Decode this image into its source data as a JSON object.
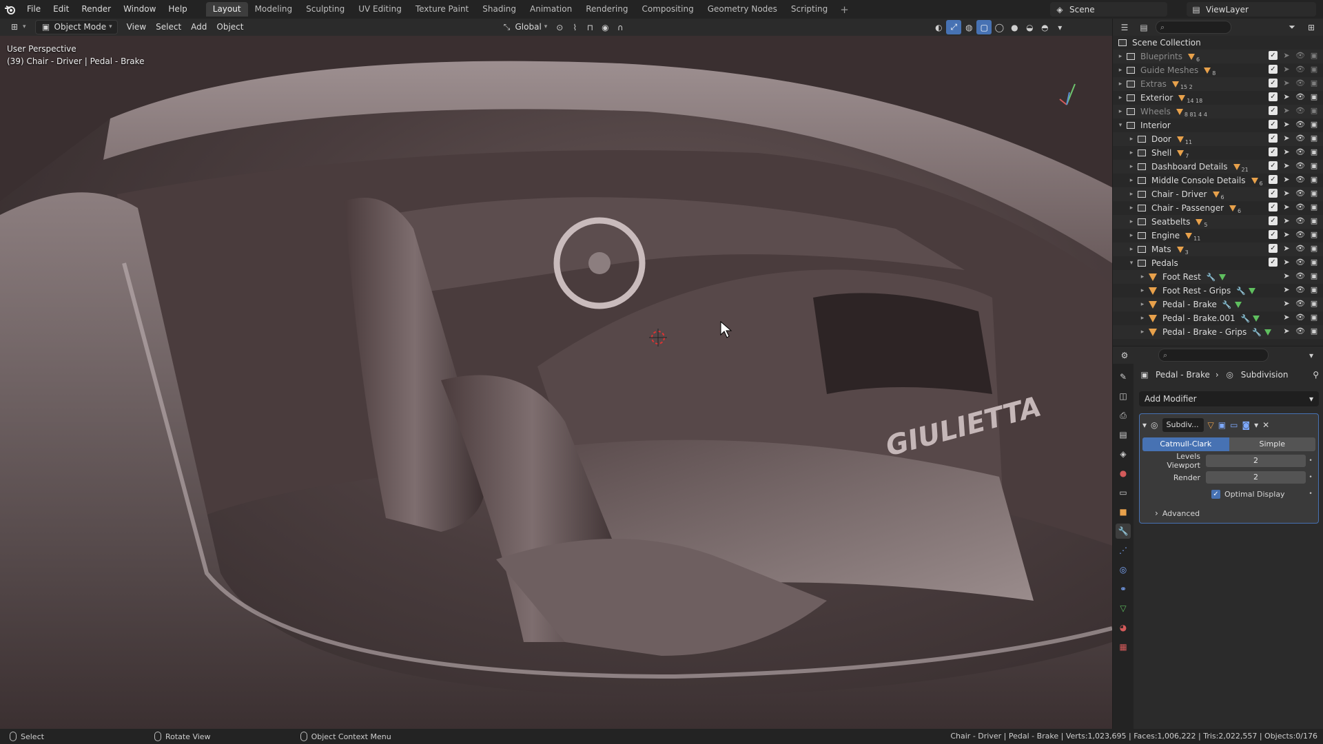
{
  "topbar": {
    "menus": [
      "File",
      "Edit",
      "Render",
      "Window",
      "Help"
    ],
    "workspaces": [
      "Layout",
      "Modeling",
      "Sculpting",
      "UV Editing",
      "Texture Paint",
      "Shading",
      "Animation",
      "Rendering",
      "Compositing",
      "Geometry Nodes",
      "Scripting"
    ],
    "active_workspace": "Layout",
    "add_workspace": "+",
    "scene": "Scene",
    "view_layer": "ViewLayer"
  },
  "viewport_header": {
    "mode": "Object Mode",
    "menus": [
      "View",
      "Select",
      "Add",
      "Object"
    ],
    "orientation": "Global"
  },
  "viewport": {
    "perspective_label": "User Perspective",
    "object_label": "(39) Chair - Driver | Pedal - Brake",
    "brand_text": "GIULIETTA"
  },
  "outliner": {
    "root": "Scene Collection",
    "rows": [
      {
        "label": "Blueprints",
        "type": "collection",
        "dim": true,
        "counts": "6"
      },
      {
        "label": "Guide Meshes",
        "type": "collection",
        "dim": true,
        "counts": "8"
      },
      {
        "label": "Extras",
        "type": "collection",
        "dim": true,
        "counts": "15  2"
      },
      {
        "label": "Exterior",
        "type": "collection",
        "dim": false,
        "counts": "14  18"
      },
      {
        "label": "Wheels",
        "type": "collection",
        "dim": true,
        "counts": "8  81  4  4"
      },
      {
        "label": "Interior",
        "type": "collection",
        "dim": false,
        "open": true
      },
      {
        "label": "Door",
        "type": "collection",
        "indent": 1,
        "counts": "11"
      },
      {
        "label": "Shell",
        "type": "collection",
        "indent": 1,
        "counts": "7"
      },
      {
        "label": "Dashboard Details",
        "type": "collection",
        "indent": 1,
        "counts": "21"
      },
      {
        "label": "Middle Console Details",
        "type": "collection",
        "indent": 1,
        "counts": "6"
      },
      {
        "label": "Chair - Driver",
        "type": "collection",
        "indent": 1,
        "counts": "6"
      },
      {
        "label": "Chair - Passenger",
        "type": "collection",
        "indent": 1,
        "counts": "6"
      },
      {
        "label": "Seatbelts",
        "type": "collection",
        "indent": 1,
        "counts": "5"
      },
      {
        "label": "Engine",
        "type": "collection",
        "indent": 1,
        "counts": "11"
      },
      {
        "label": "Mats",
        "type": "collection",
        "indent": 1,
        "counts": "3"
      },
      {
        "label": "Pedals",
        "type": "collection",
        "indent": 1,
        "open": true
      },
      {
        "label": "Foot Rest",
        "type": "mesh",
        "indent": 2
      },
      {
        "label": "Foot Rest - Grips",
        "type": "mesh",
        "indent": 2
      },
      {
        "label": "Pedal - Brake",
        "type": "mesh",
        "indent": 2
      },
      {
        "label": "Pedal - Brake.001",
        "type": "mesh",
        "indent": 2
      },
      {
        "label": "Pedal - Brake - Grips",
        "type": "mesh",
        "indent": 2
      }
    ]
  },
  "properties": {
    "breadcrumb_object": "Pedal - Brake",
    "breadcrumb_modifier": "Subdivision",
    "add_modifier": "Add Modifier",
    "modifier_name": "Subdiv...",
    "seg_a": "Catmull-Clark",
    "seg_b": "Simple",
    "levels_viewport_label": "Levels Viewport",
    "levels_viewport": "2",
    "render_label": "Render",
    "render": "2",
    "optimal_display": "Optimal Display",
    "advanced": "Advanced"
  },
  "statusbar": {
    "select": "Select",
    "rotate": "Rotate View",
    "context": "Object Context Menu",
    "stats": "Chair - Driver | Pedal - Brake | Verts:1,023,695 | Faces:1,006,222 | Tris:2,022,557 | Objects:0/176"
  },
  "colors": {
    "accent": "#4772b3",
    "mesh_icon": "#e8a14b",
    "data_icon": "#5fbf5f"
  }
}
